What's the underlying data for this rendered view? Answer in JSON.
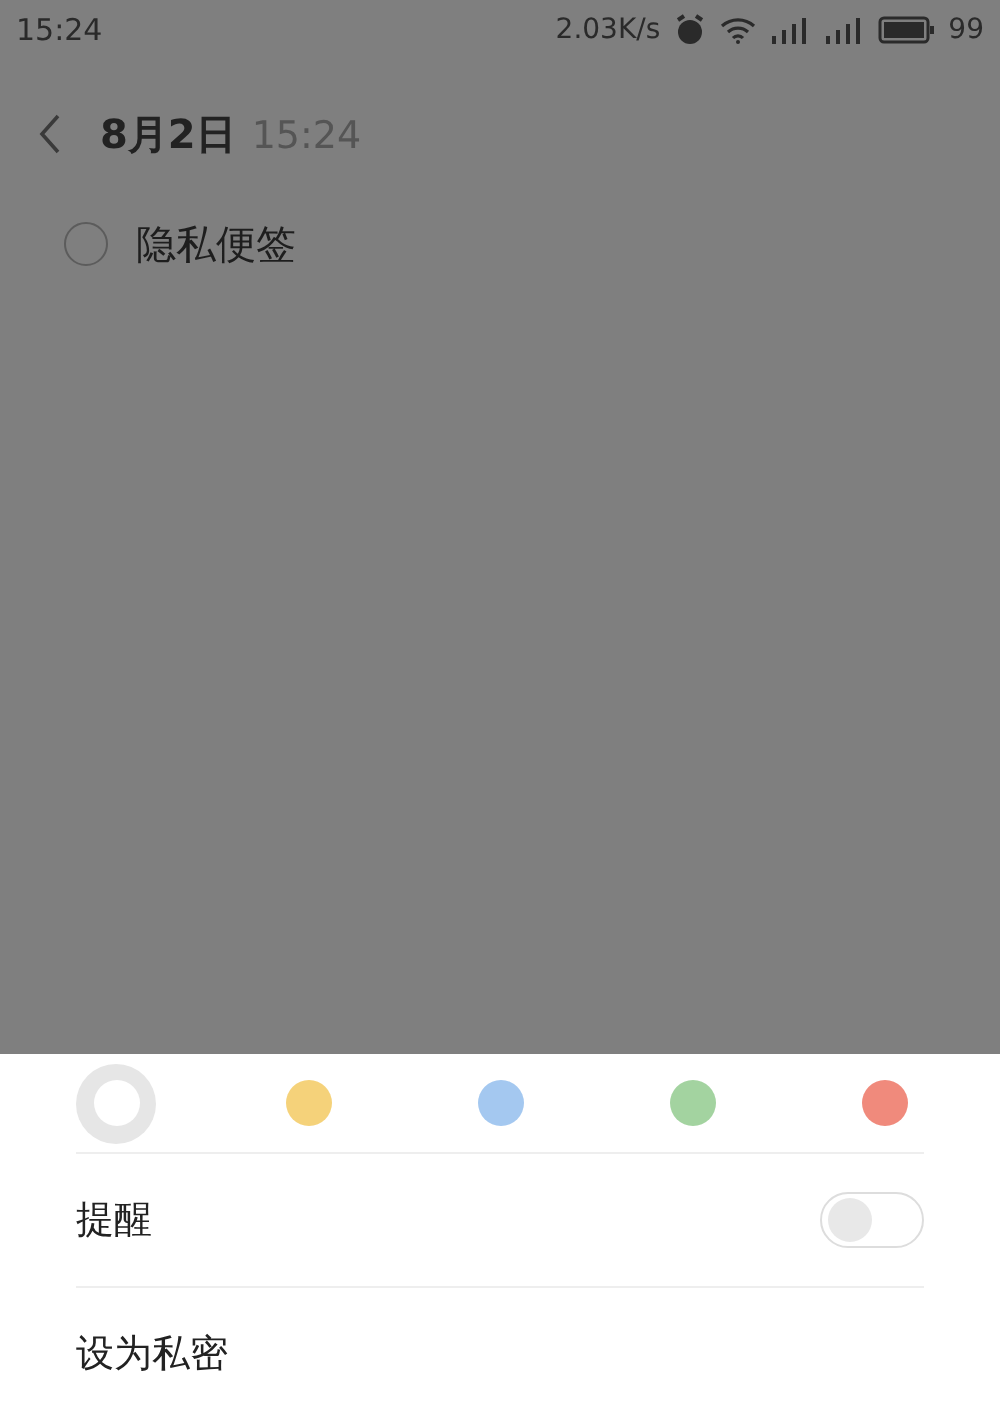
{
  "status_bar": {
    "time": "15:24",
    "speed": "2.03K/s",
    "battery": "99"
  },
  "header": {
    "date": "8月2日",
    "time": "15:24"
  },
  "note": {
    "text": "隐私便签",
    "checked": false
  },
  "sheet": {
    "colors": [
      {
        "color": "#ffffff",
        "selected": true
      },
      {
        "color": "#f5d27a",
        "selected": false
      },
      {
        "color": "#a4c8f0",
        "selected": false
      },
      {
        "color": "#a3d3a0",
        "selected": false
      },
      {
        "color": "#f08a7c",
        "selected": false
      }
    ],
    "options": [
      {
        "label": "提醒",
        "kind": "toggle",
        "on": false
      },
      {
        "label": "设为私密",
        "kind": "plain"
      }
    ]
  }
}
